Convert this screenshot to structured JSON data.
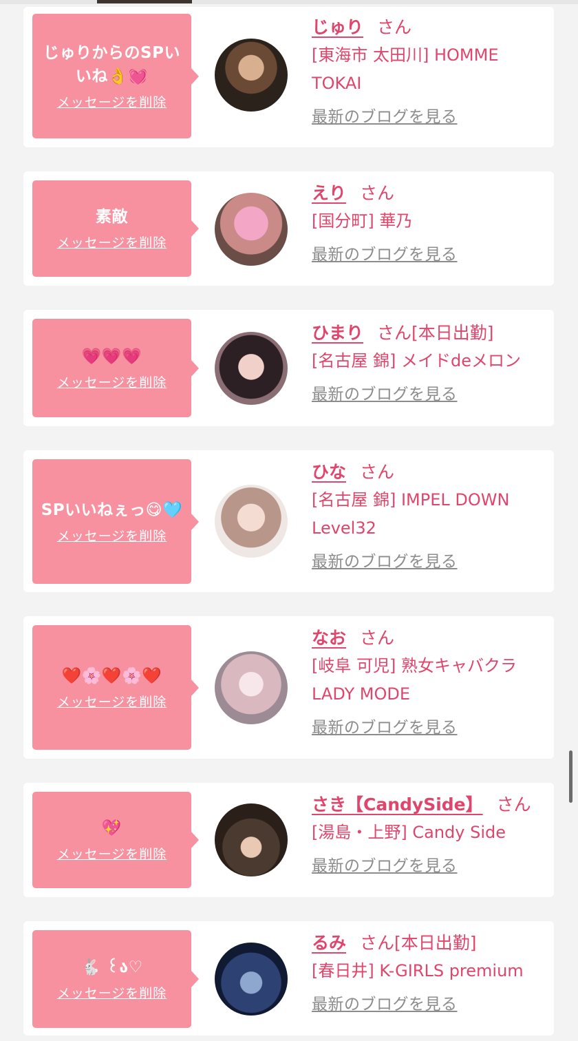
{
  "delete_label": "メッセージを削除",
  "blog_label": "最新のブログを見る",
  "honorific": "さん",
  "colors": {
    "background": "#f3f3f3",
    "card": "#ffffff",
    "bubble": "#f7919f",
    "accent_text": "#e0456b",
    "link_gray": "#8c8c8c"
  },
  "items": [
    {
      "message": "じゅりからのSPいいね👌💓",
      "name": "じゅり",
      "status": "",
      "shop": "[東海市 太田川] HOMME TOKAI"
    },
    {
      "message": "素敵",
      "name": "えり",
      "status": "",
      "shop": "[国分町] 華乃"
    },
    {
      "message": "💗💗💗",
      "name": "ひまり",
      "status": "[本日出勤]",
      "shop": "[名古屋 錦] メイドdeメロン"
    },
    {
      "message": "SPいいねぇっ😋🩵",
      "name": "ひな",
      "status": "",
      "shop": "[名古屋 錦] IMPEL DOWN Level32"
    },
    {
      "message": "❤️🌸❤️🌸❤️",
      "name": "なお",
      "status": "",
      "shop": "[岐阜 可児] 熟女キャバクラ LADY MODE"
    },
    {
      "message": "💖",
      "name": "さき【CandySide】",
      "status": "",
      "shop": "[湯島・上野] Candy Side"
    },
    {
      "message": "🐇 ꒰ა♡",
      "name": "るみ",
      "status": "[本日出勤]",
      "shop": "[春日井] K-GIRLS premium"
    }
  ]
}
